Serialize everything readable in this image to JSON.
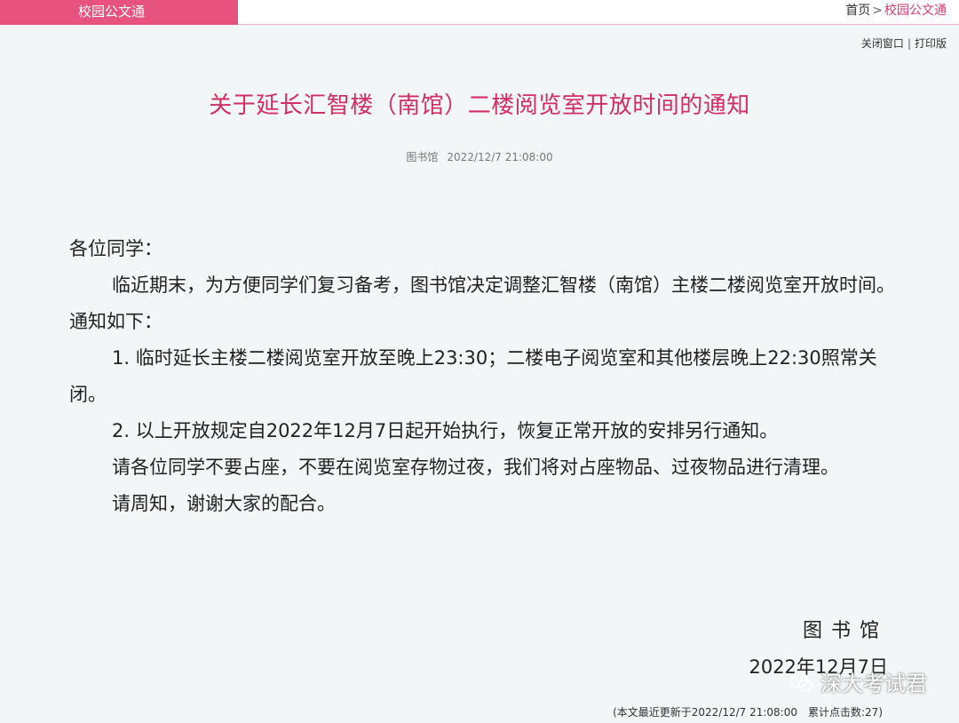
{
  "header": {
    "tab_label": "校园公文通",
    "breadcrumb": {
      "home": "首页",
      "separator": ">",
      "current": "校园公文通"
    }
  },
  "tools": {
    "close": "关闭窗口",
    "separator": "|",
    "print": "打印版"
  },
  "notice": {
    "title": "关于延长汇智楼（南馆）二楼阅览室开放时间的通知",
    "author": "图书馆",
    "datetime": "2022/12/7 21:08:00",
    "salutation": "各位同学：",
    "paragraphs": [
      "临近期末，为方便同学们复习备考，图书馆决定调整汇智楼（南馆）主楼二楼阅览室开放时间。通知如下：",
      "1. 临时延长主楼二楼阅览室开放至晚上23:30；二楼电子阅览室和其他楼层晚上22:30照常关闭。",
      "2. 以上开放规定自2022年12月7日起开始执行，恢复正常开放的安排另行通知。",
      "请各位同学不要占座，不要在阅览室存物过夜，我们将对占座物品、过夜物品进行清理。",
      "请周知，谢谢大家的配合。"
    ],
    "signature": "图书馆",
    "sign_date": "2022年12月7日"
  },
  "watermark": {
    "text": "深大考试君",
    "icon": "wechat-icon"
  },
  "footer": {
    "updated": "(本文最近更新于2022/12/7 21:08:00",
    "clicks": "累计点击数:27)"
  }
}
